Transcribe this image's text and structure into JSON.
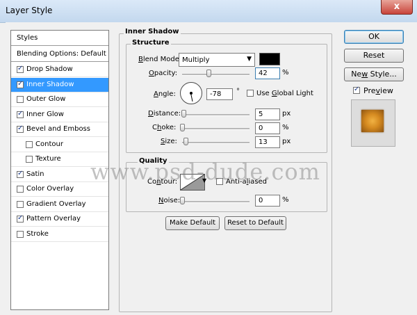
{
  "window": {
    "title": "Layer Style",
    "close_glyph": "x"
  },
  "style_list": {
    "header": "Styles",
    "blending": "Blending Options: Default",
    "items": [
      {
        "label": "Drop Shadow",
        "checked": true,
        "indent": false
      },
      {
        "label": "Inner Shadow",
        "checked": true,
        "indent": false,
        "selected": true
      },
      {
        "label": "Outer Glow",
        "checked": false,
        "indent": false
      },
      {
        "label": "Inner Glow",
        "checked": true,
        "indent": false
      },
      {
        "label": "Bevel and Emboss",
        "checked": true,
        "indent": false
      },
      {
        "label": "Contour",
        "checked": false,
        "indent": true
      },
      {
        "label": "Texture",
        "checked": false,
        "indent": true
      },
      {
        "label": "Satin",
        "checked": true,
        "indent": false
      },
      {
        "label": "Color Overlay",
        "checked": false,
        "indent": false
      },
      {
        "label": "Gradient Overlay",
        "checked": false,
        "indent": false
      },
      {
        "label": "Pattern Overlay",
        "checked": true,
        "indent": false
      },
      {
        "label": "Stroke",
        "checked": false,
        "indent": false
      }
    ]
  },
  "panel": {
    "title": "Inner Shadow",
    "structure": {
      "title": "Structure",
      "blend_mode_label": "Blend Mode:",
      "blend_mode_value": "Multiply",
      "shadow_color": "#000000",
      "opacity_label": "Opacity:",
      "opacity_value": "42",
      "opacity_unit": "%",
      "opacity_level": 0.42,
      "angle_label": "Angle:",
      "angle_value": "-78",
      "angle_unit": "°",
      "global_light_label": "Use Global Light",
      "global_light_checked": false,
      "distance_label": "Distance:",
      "distance_value": "5",
      "distance_unit": "px",
      "distance_level": 0.02,
      "choke_label": "Choke:",
      "choke_value": "0",
      "choke_unit": "%",
      "choke_level": 0.0,
      "size_label": "Size:",
      "size_value": "13",
      "size_unit": "px",
      "size_level": 0.05
    },
    "quality": {
      "title": "Quality",
      "contour_label": "Contour:",
      "anti_aliased_label": "Anti-aliased",
      "anti_aliased_checked": false,
      "noise_label": "Noise:",
      "noise_value": "0",
      "noise_unit": "%",
      "noise_level": 0.0
    },
    "make_default": "Make Default",
    "reset_default": "Reset to Default"
  },
  "buttons": {
    "ok": "OK",
    "reset": "Reset",
    "new_style": "New Style...",
    "preview_label": "Preview",
    "preview_checked": true
  },
  "watermark": "www.psd-dude.com"
}
